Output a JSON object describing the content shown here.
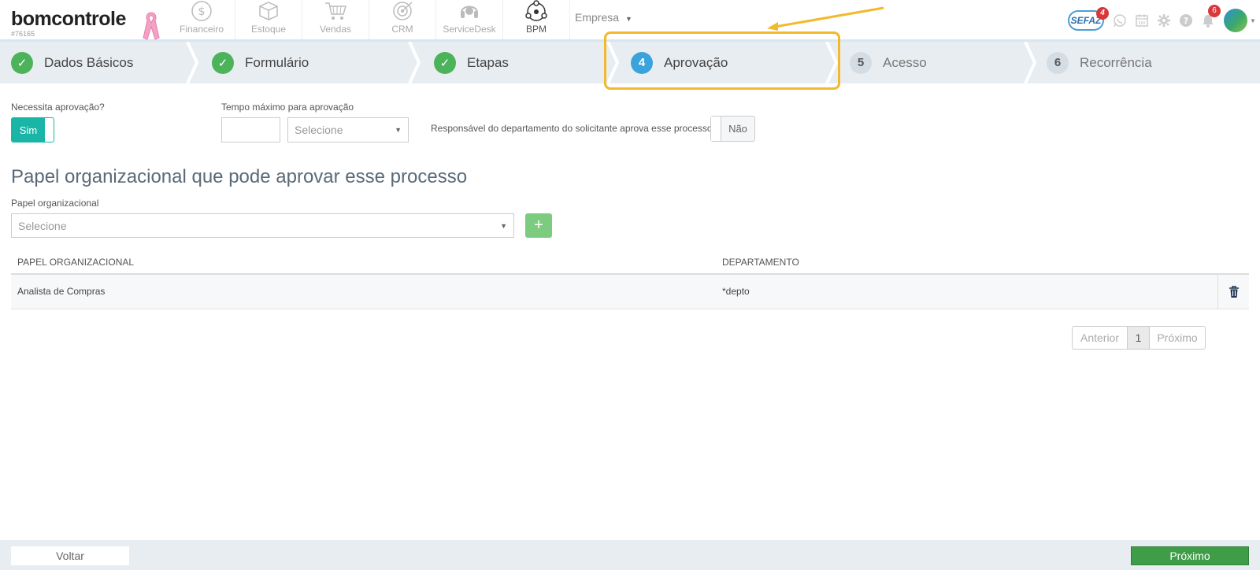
{
  "header": {
    "logo_text": "bomcontrole",
    "account_id": "#76165",
    "modules": [
      {
        "label": "Financeiro",
        "icon": "dollar-circle-icon"
      },
      {
        "label": "Estoque",
        "icon": "box-icon"
      },
      {
        "label": "Vendas",
        "icon": "cart-icon"
      },
      {
        "label": "CRM",
        "icon": "target-icon"
      },
      {
        "label": "ServiceDesk",
        "icon": "headset-icon"
      },
      {
        "label": "BPM",
        "icon": "bpm-network-icon"
      }
    ],
    "company_selector": "Empresa",
    "sefaz_label": "SEFAZ",
    "sefaz_badge": "4",
    "notifications_badge": "6"
  },
  "steps": [
    {
      "num": "1",
      "label": "Dados Básicos",
      "state": "done"
    },
    {
      "num": "2",
      "label": "Formulário",
      "state": "done"
    },
    {
      "num": "3",
      "label": "Etapas",
      "state": "done"
    },
    {
      "num": "4",
      "label": "Aprovação",
      "state": "current"
    },
    {
      "num": "5",
      "label": "Acesso",
      "state": "todo"
    },
    {
      "num": "6",
      "label": "Recorrência",
      "state": "todo"
    }
  ],
  "form": {
    "needs_approval_label": "Necessita aprovação?",
    "needs_approval_value": "Sim",
    "max_time_label": "Tempo máximo para aprovação",
    "max_time_value": "",
    "max_time_unit_placeholder": "Selecione",
    "dept_manager_label": "Responsável do departamento do solicitante aprova esse processo",
    "dept_manager_value": "Não",
    "section_title": "Papel organizacional que pode aprovar esse processo",
    "role_label": "Papel organizacional",
    "role_placeholder": "Selecione",
    "add_button": "+"
  },
  "table": {
    "columns": [
      "PAPEL ORGANIZACIONAL",
      "DEPARTAMENTO"
    ],
    "rows": [
      {
        "role": "Analista de Compras",
        "department": "*depto"
      }
    ]
  },
  "pagination": {
    "prev": "Anterior",
    "page": "1",
    "next": "Próximo"
  },
  "footer": {
    "back": "Voltar",
    "next": "Próximo"
  },
  "colors": {
    "done": "#4cb35a",
    "current": "#3ba3dc",
    "toggle_on": "#19b5a6",
    "highlight": "#f2b92c",
    "primary_button": "#3f9d47"
  }
}
